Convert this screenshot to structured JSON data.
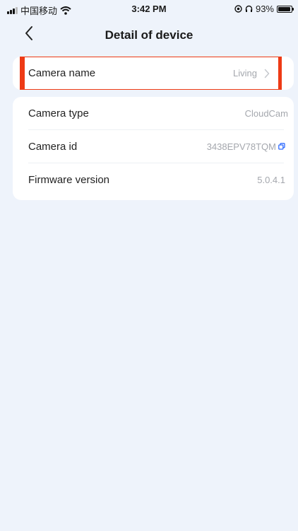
{
  "status_bar": {
    "carrier": "中国移动",
    "time": "3:42 PM",
    "battery": "93%",
    "battery_level": 0.93
  },
  "nav": {
    "title": "Detail of device"
  },
  "rows": {
    "camera_name": {
      "label": "Camera name",
      "value": "Living"
    },
    "camera_type": {
      "label": "Camera type",
      "value": "CloudCam"
    },
    "camera_id": {
      "label": "Camera id",
      "value": "3438EPV78TQM"
    },
    "firmware": {
      "label": "Firmware version",
      "value": "5.0.4.1"
    }
  },
  "colors": {
    "background": "#eef3fb",
    "highlight": "#ee3a15",
    "value_text": "#a4a7ad",
    "copy_icon": "#2f6bff"
  },
  "icons": {
    "back": "chevron-left-icon",
    "chevron": "chevron-right-icon",
    "copy": "copy-icon"
  }
}
